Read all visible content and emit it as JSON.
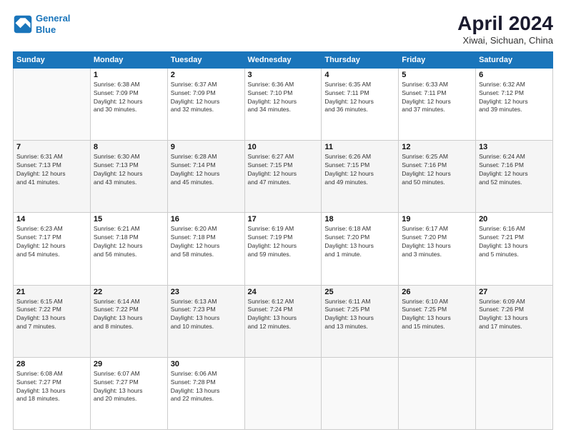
{
  "header": {
    "logo_line1": "General",
    "logo_line2": "Blue",
    "title": "April 2024",
    "subtitle": "Xiwai, Sichuan, China"
  },
  "days_of_week": [
    "Sunday",
    "Monday",
    "Tuesday",
    "Wednesday",
    "Thursday",
    "Friday",
    "Saturday"
  ],
  "weeks": [
    [
      {
        "day": "",
        "info": ""
      },
      {
        "day": "1",
        "info": "Sunrise: 6:38 AM\nSunset: 7:09 PM\nDaylight: 12 hours\nand 30 minutes."
      },
      {
        "day": "2",
        "info": "Sunrise: 6:37 AM\nSunset: 7:09 PM\nDaylight: 12 hours\nand 32 minutes."
      },
      {
        "day": "3",
        "info": "Sunrise: 6:36 AM\nSunset: 7:10 PM\nDaylight: 12 hours\nand 34 minutes."
      },
      {
        "day": "4",
        "info": "Sunrise: 6:35 AM\nSunset: 7:11 PM\nDaylight: 12 hours\nand 36 minutes."
      },
      {
        "day": "5",
        "info": "Sunrise: 6:33 AM\nSunset: 7:11 PM\nDaylight: 12 hours\nand 37 minutes."
      },
      {
        "day": "6",
        "info": "Sunrise: 6:32 AM\nSunset: 7:12 PM\nDaylight: 12 hours\nand 39 minutes."
      }
    ],
    [
      {
        "day": "7",
        "info": "Sunrise: 6:31 AM\nSunset: 7:13 PM\nDaylight: 12 hours\nand 41 minutes."
      },
      {
        "day": "8",
        "info": "Sunrise: 6:30 AM\nSunset: 7:13 PM\nDaylight: 12 hours\nand 43 minutes."
      },
      {
        "day": "9",
        "info": "Sunrise: 6:28 AM\nSunset: 7:14 PM\nDaylight: 12 hours\nand 45 minutes."
      },
      {
        "day": "10",
        "info": "Sunrise: 6:27 AM\nSunset: 7:15 PM\nDaylight: 12 hours\nand 47 minutes."
      },
      {
        "day": "11",
        "info": "Sunrise: 6:26 AM\nSunset: 7:15 PM\nDaylight: 12 hours\nand 49 minutes."
      },
      {
        "day": "12",
        "info": "Sunrise: 6:25 AM\nSunset: 7:16 PM\nDaylight: 12 hours\nand 50 minutes."
      },
      {
        "day": "13",
        "info": "Sunrise: 6:24 AM\nSunset: 7:16 PM\nDaylight: 12 hours\nand 52 minutes."
      }
    ],
    [
      {
        "day": "14",
        "info": "Sunrise: 6:23 AM\nSunset: 7:17 PM\nDaylight: 12 hours\nand 54 minutes."
      },
      {
        "day": "15",
        "info": "Sunrise: 6:21 AM\nSunset: 7:18 PM\nDaylight: 12 hours\nand 56 minutes."
      },
      {
        "day": "16",
        "info": "Sunrise: 6:20 AM\nSunset: 7:18 PM\nDaylight: 12 hours\nand 58 minutes."
      },
      {
        "day": "17",
        "info": "Sunrise: 6:19 AM\nSunset: 7:19 PM\nDaylight: 12 hours\nand 59 minutes."
      },
      {
        "day": "18",
        "info": "Sunrise: 6:18 AM\nSunset: 7:20 PM\nDaylight: 13 hours\nand 1 minute."
      },
      {
        "day": "19",
        "info": "Sunrise: 6:17 AM\nSunset: 7:20 PM\nDaylight: 13 hours\nand 3 minutes."
      },
      {
        "day": "20",
        "info": "Sunrise: 6:16 AM\nSunset: 7:21 PM\nDaylight: 13 hours\nand 5 minutes."
      }
    ],
    [
      {
        "day": "21",
        "info": "Sunrise: 6:15 AM\nSunset: 7:22 PM\nDaylight: 13 hours\nand 7 minutes."
      },
      {
        "day": "22",
        "info": "Sunrise: 6:14 AM\nSunset: 7:22 PM\nDaylight: 13 hours\nand 8 minutes."
      },
      {
        "day": "23",
        "info": "Sunrise: 6:13 AM\nSunset: 7:23 PM\nDaylight: 13 hours\nand 10 minutes."
      },
      {
        "day": "24",
        "info": "Sunrise: 6:12 AM\nSunset: 7:24 PM\nDaylight: 13 hours\nand 12 minutes."
      },
      {
        "day": "25",
        "info": "Sunrise: 6:11 AM\nSunset: 7:25 PM\nDaylight: 13 hours\nand 13 minutes."
      },
      {
        "day": "26",
        "info": "Sunrise: 6:10 AM\nSunset: 7:25 PM\nDaylight: 13 hours\nand 15 minutes."
      },
      {
        "day": "27",
        "info": "Sunrise: 6:09 AM\nSunset: 7:26 PM\nDaylight: 13 hours\nand 17 minutes."
      }
    ],
    [
      {
        "day": "28",
        "info": "Sunrise: 6:08 AM\nSunset: 7:27 PM\nDaylight: 13 hours\nand 18 minutes."
      },
      {
        "day": "29",
        "info": "Sunrise: 6:07 AM\nSunset: 7:27 PM\nDaylight: 13 hours\nand 20 minutes."
      },
      {
        "day": "30",
        "info": "Sunrise: 6:06 AM\nSunset: 7:28 PM\nDaylight: 13 hours\nand 22 minutes."
      },
      {
        "day": "",
        "info": ""
      },
      {
        "day": "",
        "info": ""
      },
      {
        "day": "",
        "info": ""
      },
      {
        "day": "",
        "info": ""
      }
    ]
  ]
}
